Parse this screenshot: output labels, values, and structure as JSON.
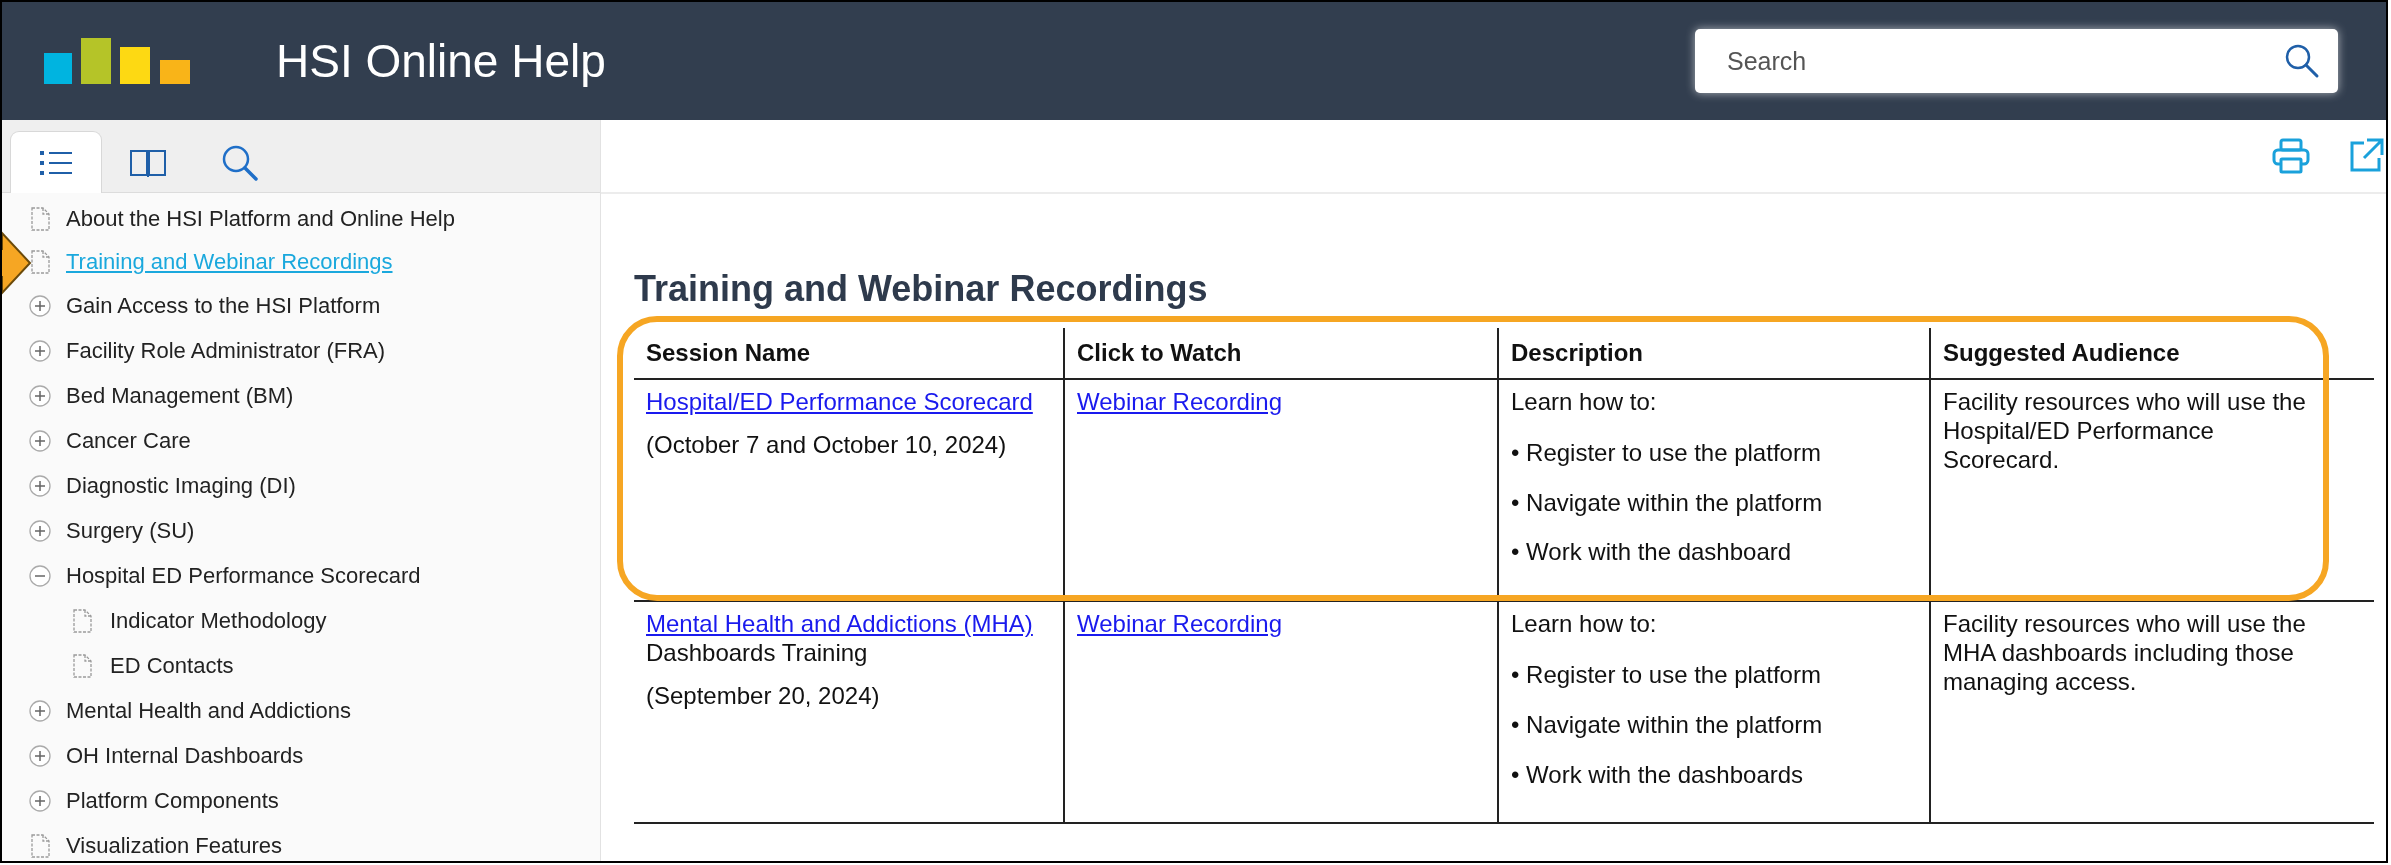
{
  "header": {
    "title": "HSI Online Help",
    "search": {
      "placeholder": "Search"
    }
  },
  "sidebar": {
    "tabs": [
      {
        "kind": "contents",
        "selected": true
      },
      {
        "kind": "index",
        "selected": false
      },
      {
        "kind": "search",
        "selected": false
      }
    ],
    "items": [
      {
        "label": "About the HSI Platform and Online Help",
        "kind": "page",
        "selected": false
      },
      {
        "label": "Training and Webinar Recordings",
        "kind": "page",
        "selected": true
      },
      {
        "label": "Gain Access to the HSI Platform",
        "kind": "folder",
        "expanded": false,
        "selected": false
      },
      {
        "label": "Facility Role Administrator (FRA)",
        "kind": "folder",
        "expanded": false,
        "selected": false
      },
      {
        "label": "Bed Management (BM)",
        "kind": "folder",
        "expanded": false,
        "selected": false
      },
      {
        "label": "Cancer Care",
        "kind": "folder",
        "expanded": false,
        "selected": false
      },
      {
        "label": "Diagnostic Imaging (DI)",
        "kind": "folder",
        "expanded": false,
        "selected": false
      },
      {
        "label": "Surgery (SU)",
        "kind": "folder",
        "expanded": false,
        "selected": false
      },
      {
        "label": "Hospital ED Performance Scorecard",
        "kind": "folder",
        "expanded": true,
        "selected": false,
        "children": [
          {
            "label": "Indicator Methodology",
            "kind": "page",
            "selected": false
          },
          {
            "label": "ED Contacts",
            "kind": "page",
            "selected": false
          }
        ]
      },
      {
        "label": "Mental Health and Addictions",
        "kind": "folder",
        "expanded": false,
        "selected": false
      },
      {
        "label": "OH Internal Dashboards",
        "kind": "folder",
        "expanded": false,
        "selected": false
      },
      {
        "label": "Platform Components",
        "kind": "folder",
        "expanded": false,
        "selected": false
      },
      {
        "label": "Visualization Features",
        "kind": "page",
        "selected": false
      }
    ]
  },
  "content": {
    "heading": "Training and Webinar Recordings",
    "table": {
      "columns": [
        "Session Name",
        "Click to Watch",
        "Description",
        "Suggested Audience"
      ],
      "rows": [
        {
          "session_link": "Hospital/ED Performance Scorecard",
          "date": "(October 7 and October 10, 2024)",
          "watch_link": "Webinar Recording",
          "description": [
            "Learn how to:",
            "• Register to use the platform",
            "• Navigate within the platform",
            "• Work with the dashboard"
          ],
          "audience": "Facility resources who will use the Hospital/ED Performance Scorecard.",
          "highlighted": true
        },
        {
          "session_link": "Mental Health and Addictions (MHA)",
          "session_rest": " Dashboards Training",
          "date": "(September 20, 2024)",
          "watch_link": "Webinar Recording",
          "description": [
            "Learn how to:",
            "• Register to use the platform",
            "• Navigate within the platform",
            "• Work with the dashboards"
          ],
          "audience": "Facility resources who will use the MHA dashboards including those managing access.",
          "highlighted": false
        }
      ]
    }
  },
  "annotations": {
    "pointer_arrow": true
  }
}
